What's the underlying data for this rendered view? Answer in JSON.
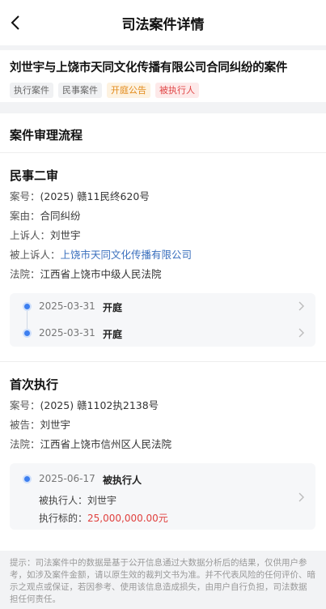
{
  "nav": {
    "title": "司法案件详情"
  },
  "case": {
    "title": "刘世宇与上饶市天同文化传播有限公司合同纠纷的案件",
    "tags": [
      "执行案件",
      "民事案件",
      "开庭公告",
      "被执行人"
    ]
  },
  "process": {
    "title": "案件审理流程",
    "stage1": {
      "name": "民事二审",
      "case_no_label": "案号：",
      "case_no": "(2025) 赣11民终620号",
      "cause_label": "案由：",
      "cause": "合同纠纷",
      "appellant_label": "上诉人：",
      "appellant": "刘世宇",
      "appellee_label": "被上诉人：",
      "appellee": "上饶市天同文化传播有限公司",
      "court_label": "法院：",
      "court": "江西省上饶市中级人民法院",
      "events": [
        {
          "date": "2025-03-31",
          "event": "开庭"
        },
        {
          "date": "2025-03-31",
          "event": "开庭"
        }
      ]
    },
    "stage2": {
      "name": "首次执行",
      "case_no_label": "案号：",
      "case_no": "(2025) 赣1102执2138号",
      "defendant_label": "被告：",
      "defendant": "刘世宇",
      "court_label": "法院：",
      "court": "江西省上饶市信州区人民法院",
      "event": {
        "date": "2025-06-17",
        "event": "被执行人",
        "person_label": "被执行人：",
        "person": "刘世宇",
        "amount_label": "执行标的：",
        "amount": "25,000,000.00元"
      }
    }
  },
  "notice": {
    "line1": "提示：司法案件中的数据是基于公开信息通过大数据分析后的结果，仅供用户参",
    "line2": "考，如涉及案件金额，请以原生效的裁判文书为准。并不代表风险的任何评价、暗",
    "line3": "示之观点或保证，若因参考、使用该信息造成损失，由用户自行负担，司法数据",
    "line4": "担任何责任。"
  }
}
